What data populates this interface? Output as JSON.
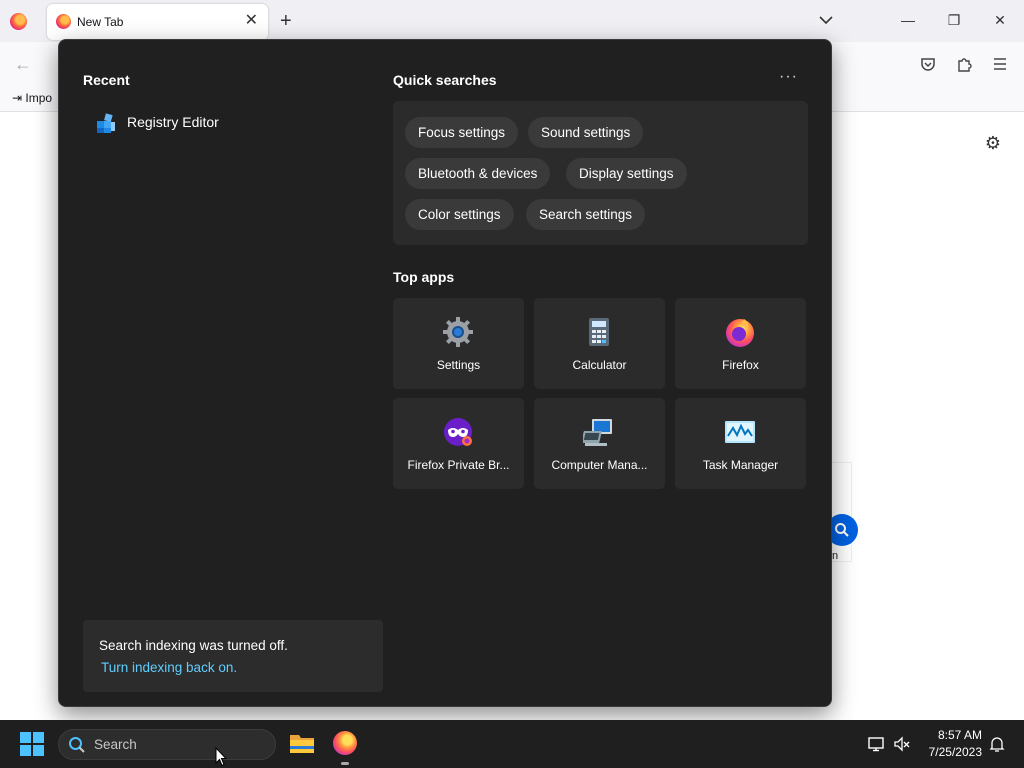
{
  "browser": {
    "tab_title": "New Tab",
    "tab_close": "✕",
    "new_tab": "+",
    "bookmark_partial": "Impo",
    "minimize": "—",
    "restore": "❐",
    "close": "✕",
    "back": "←"
  },
  "content": {
    "partial_text": "n"
  },
  "flyout": {
    "recent_title": "Recent",
    "recent_items": [
      {
        "label": "Registry Editor",
        "icon": "registry-editor-icon"
      }
    ],
    "quick_searches_title": "Quick searches",
    "more_label": "···",
    "quick_searches": [
      "Focus settings",
      "Sound settings",
      "Bluetooth & devices",
      "Display settings",
      "Color settings",
      "Search settings"
    ],
    "top_apps_title": "Top apps",
    "top_apps": [
      {
        "label": "Settings",
        "icon": "settings-icon"
      },
      {
        "label": "Calculator",
        "icon": "calculator-icon"
      },
      {
        "label": "Firefox",
        "icon": "firefox-icon"
      },
      {
        "label": "Firefox Private Br...",
        "icon": "firefox-private-icon"
      },
      {
        "label": "Computer Mana...",
        "icon": "computer-management-icon"
      },
      {
        "label": "Task Manager",
        "icon": "task-manager-icon"
      }
    ],
    "indexing_message": "Search indexing was turned off.",
    "indexing_link": "Turn indexing back on."
  },
  "taskbar": {
    "search_placeholder": "Search",
    "time": "8:57 AM",
    "date": "7/25/2023"
  },
  "colors": {
    "flyout_bg": "#202020",
    "tile_bg": "#2b2b2b",
    "link": "#60cdff",
    "accent": "#4cc2ff"
  }
}
